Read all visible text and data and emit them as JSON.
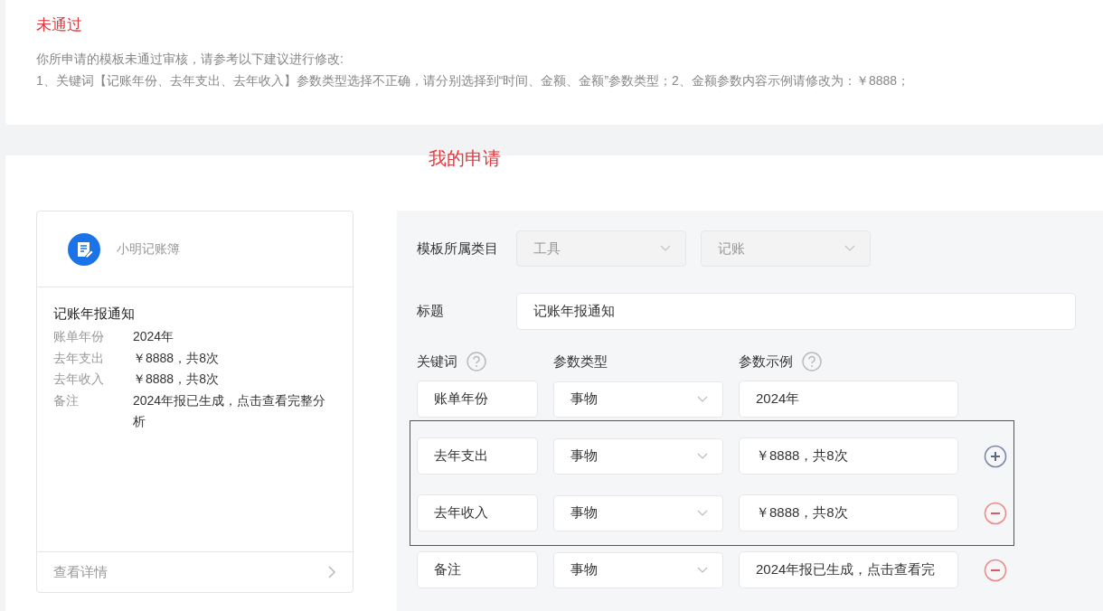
{
  "review": {
    "status": "未通过",
    "intro": "你所申请的模板未通过审核，请参考以下建议进行修改:",
    "suggestion": "1、关键词【记账年份、去年支出、去年收入】参数类型选择不正确，请分别选择到“时间、金额、金额”参数类型；2、金额参数内容示例请修改为：￥8888；"
  },
  "application": {
    "title": "我的申请",
    "preview": {
      "app_name": "小明记账簿",
      "message_title": "记账年报通知",
      "fields": [
        {
          "label": "账单年份",
          "value": "2024年"
        },
        {
          "label": "去年支出",
          "value": "￥8888，共8次"
        },
        {
          "label": "去年收入",
          "value": "￥8888，共8次"
        },
        {
          "label": "备注",
          "value": "2024年报已生成，点击查看完整分析"
        }
      ],
      "footer_link": "查看详情"
    },
    "form": {
      "category_label": "模板所属类目",
      "categories": [
        {
          "value": "工具",
          "disabled": true
        },
        {
          "value": "记账",
          "disabled": true
        }
      ],
      "title_label": "标题",
      "title_value": "记账年报通知",
      "columns": [
        {
          "label": "关键词",
          "help": true
        },
        {
          "label": "参数类型",
          "help": false
        },
        {
          "label": "参数示例",
          "help": true
        }
      ],
      "keywords": [
        {
          "keyword": "账单年份",
          "type": "事物",
          "example": "2024年",
          "highlighted": false,
          "kind": "plain"
        },
        {
          "keyword": "去年支出",
          "type": "事物",
          "example": "￥8888，共8次",
          "highlighted": true,
          "kind": "add"
        },
        {
          "keyword": "去年收入",
          "type": "事物",
          "example": "￥8888，共8次",
          "highlighted": true,
          "kind": "remove"
        },
        {
          "keyword": "备注",
          "type": "事物",
          "example": "2024年报已生成，点击查看完",
          "highlighted": false,
          "kind": "remove"
        }
      ]
    }
  }
}
